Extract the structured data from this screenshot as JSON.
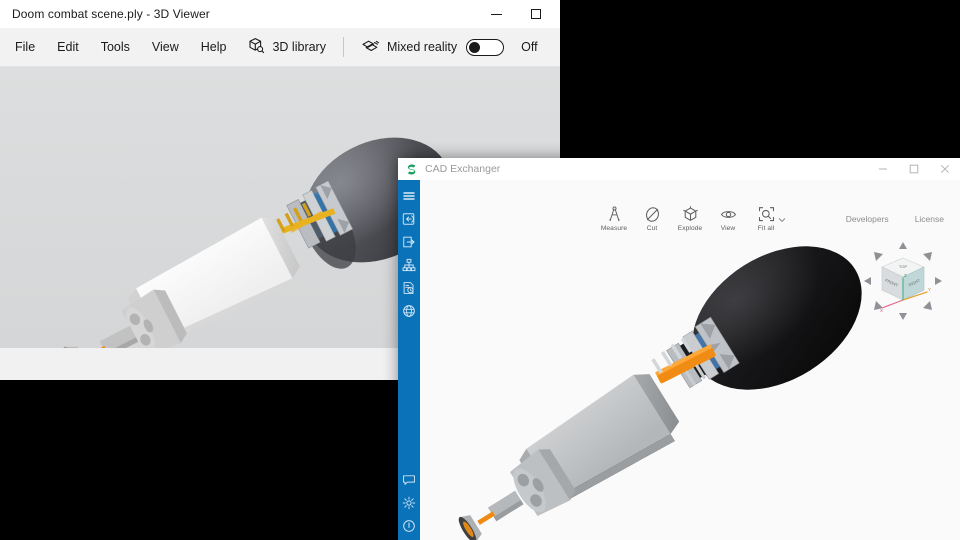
{
  "desktop": {
    "background_color": "#000000"
  },
  "viewer_window": {
    "app": "3D Viewer",
    "title": "Doom combat scene.ply - 3D Viewer",
    "window_controls": [
      {
        "name": "minimize",
        "glyph": "–"
      },
      {
        "name": "maximize",
        "glyph": "□"
      }
    ],
    "menubar": {
      "items": [
        {
          "label": "File"
        },
        {
          "label": "Edit"
        },
        {
          "label": "Tools"
        },
        {
          "label": "View"
        },
        {
          "label": "Help"
        }
      ],
      "library_button": {
        "label": "3D library",
        "icon": "cube-search-icon"
      },
      "mixed_reality": {
        "label": "Mixed reality",
        "icon": "mixed-reality-icon",
        "toggle_state": "Off",
        "toggle_on": false
      }
    },
    "canvas": {
      "background_top": "#dcdedf",
      "background_bottom": "#d4d6d7",
      "model_name": "microphone-assembly"
    },
    "statusbar": {
      "background": "#f1f1f1"
    }
  },
  "cad_window": {
    "app": "CAD Exchanger",
    "title": "CAD Exchanger",
    "logo_color": "#1aa260",
    "accent_color": "#0a72b8",
    "window_controls": [
      {
        "name": "minimize",
        "glyph": "–"
      },
      {
        "name": "maximize",
        "glyph": "□"
      },
      {
        "name": "close",
        "glyph": "×"
      }
    ],
    "sidebar": {
      "background": "#0a72b8",
      "top_items": [
        {
          "name": "menu",
          "icon": "hamburger-menu-icon"
        },
        {
          "name": "import",
          "icon": "import-icon"
        },
        {
          "name": "export",
          "icon": "export-icon"
        },
        {
          "name": "structure",
          "icon": "assembly-tree-icon"
        },
        {
          "name": "inspect",
          "icon": "document-inspect-icon"
        },
        {
          "name": "web",
          "icon": "globe-icon"
        }
      ],
      "bottom_items": [
        {
          "name": "feedback",
          "icon": "chat-bubble-icon"
        },
        {
          "name": "settings",
          "icon": "gear-icon"
        },
        {
          "name": "about",
          "icon": "info-icon"
        }
      ]
    },
    "toolbar": [
      {
        "label": "Measure",
        "icon": "measure-icon"
      },
      {
        "label": "Cut",
        "icon": "cut-plane-icon"
      },
      {
        "label": "Explode",
        "icon": "explode-cube-icon"
      },
      {
        "label": "View",
        "icon": "eye-icon"
      },
      {
        "label": "Fit all",
        "icon": "fit-all-icon",
        "has_dropdown": true
      }
    ],
    "links": [
      {
        "label": "Developers"
      },
      {
        "label": "License"
      }
    ],
    "navigation_cube": {
      "name": "view-cube",
      "faces": [
        "TOP",
        "FRONT",
        "RIGHT"
      ],
      "axes": [
        "X",
        "Y",
        "Z"
      ],
      "arrows": [
        "up",
        "down",
        "left",
        "right",
        "up-left",
        "up-right",
        "down-left",
        "down-right"
      ]
    },
    "canvas": {
      "background": "#fafafa",
      "model_name": "microphone-assembly"
    }
  }
}
